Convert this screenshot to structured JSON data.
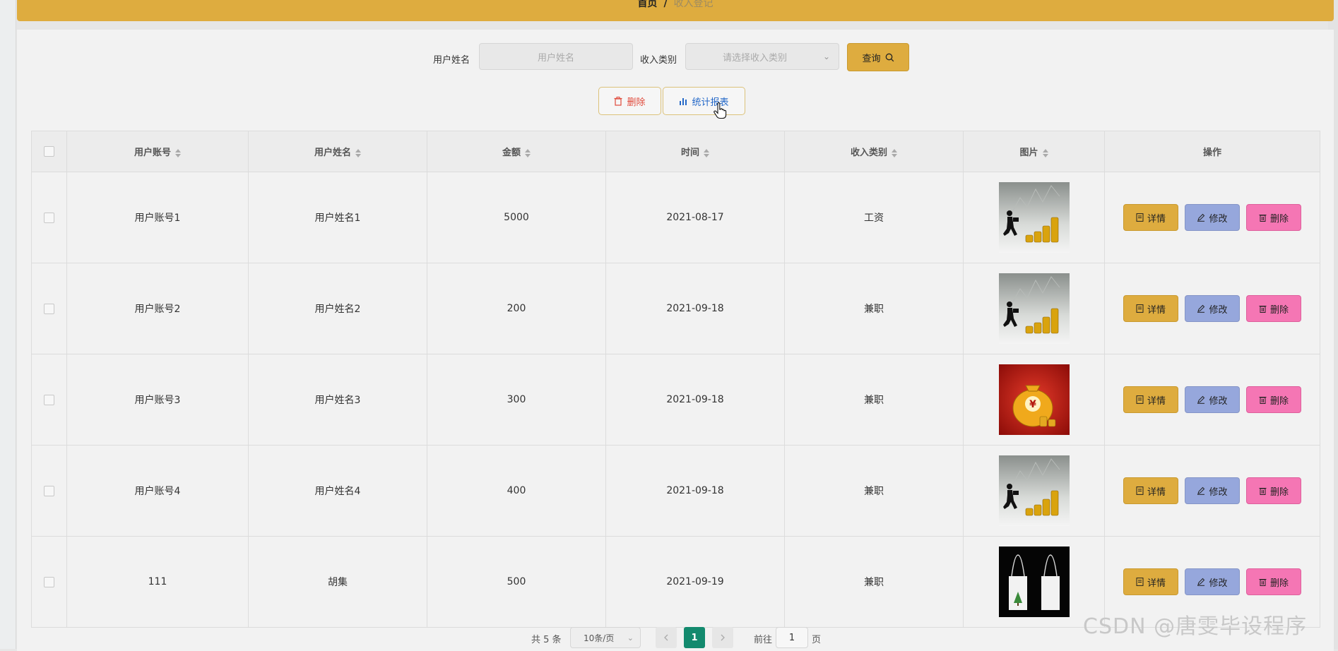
{
  "breadcrumb": {
    "home": "首页",
    "separator": "/",
    "current": "收入登记"
  },
  "search": {
    "name_label": "用户姓名",
    "name_placeholder": "用户姓名",
    "category_label": "收入类别",
    "category_placeholder": "请选择收入类别",
    "query_label": "查询"
  },
  "actions": {
    "delete_label": "删除",
    "report_label": "统计报表"
  },
  "table": {
    "headers": [
      "用户账号",
      "用户姓名",
      "金额",
      "时间",
      "收入类别",
      "图片",
      "操作"
    ],
    "rows": [
      {
        "account": "用户账号1",
        "name": "用户姓名1",
        "amount": "5000",
        "date": "2021-08-17",
        "category": "工资",
        "image": "businessman-coins"
      },
      {
        "account": "用户账号2",
        "name": "用户姓名2",
        "amount": "200",
        "date": "2021-09-18",
        "category": "兼职",
        "image": "businessman-coins"
      },
      {
        "account": "用户账号3",
        "name": "用户姓名3",
        "amount": "300",
        "date": "2021-09-18",
        "category": "兼职",
        "image": "money-bag"
      },
      {
        "account": "用户账号4",
        "name": "用户姓名4",
        "amount": "400",
        "date": "2021-09-18",
        "category": "兼职",
        "image": "businessman-coins"
      },
      {
        "account": "111",
        "name": "胡集",
        "amount": "500",
        "date": "2021-09-19",
        "category": "兼职",
        "image": "tote-bags"
      }
    ],
    "row_buttons": {
      "detail": "详情",
      "edit": "修改",
      "delete": "删除"
    }
  },
  "pagination": {
    "total": "共 5 条",
    "page_size": "10条/页",
    "current_page": "1",
    "goto_label": "前往",
    "goto_value": "1",
    "page_unit": "页"
  },
  "watermark": "CSDN @唐雯毕设程序",
  "colors": {
    "accent": "#deac3f",
    "edit": "#96a7dc",
    "delete": "#f576b4",
    "page_active": "#138a6e"
  }
}
